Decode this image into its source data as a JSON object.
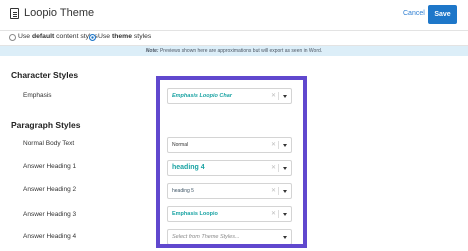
{
  "header": {
    "title": "Loopio Theme",
    "cancel_label": "Cancel",
    "save_label": "Save"
  },
  "content_styles": {
    "default_prefix": "Use",
    "default_strong": "default",
    "default_suffix": "content styles",
    "theme_prefix": "Use",
    "theme_strong": "theme",
    "theme_suffix": "styles",
    "selected": "theme"
  },
  "note": {
    "label": "Note:",
    "text": "Previews shown here are approximations but will export as seen in Word."
  },
  "sections": {
    "character_title": "Character Styles",
    "paragraph_title": "Paragraph Styles"
  },
  "rows": {
    "emphasis": {
      "label": "Emphasis",
      "value": "Emphasis Loopio Char",
      "clear": "✕"
    },
    "normal_body": {
      "label": "Normal Body Text",
      "value": "Normal",
      "clear": "✕"
    },
    "answer_h1": {
      "label": "Answer Heading 1",
      "value": "heading 4",
      "clear": "✕"
    },
    "answer_h2": {
      "label": "Answer Heading 2",
      "value": "heading 5",
      "clear": "✕"
    },
    "answer_h3": {
      "label": "Answer Heading 3",
      "value": "Emphasis Loopio",
      "clear": "✕"
    },
    "answer_h4": {
      "label": "Answer Heading 4",
      "placeholder": "Select from Theme Styles..."
    }
  },
  "colors": {
    "accent": "#1e77c9",
    "teal_style": "#1aa3a3",
    "highlight_border": "#6048ce",
    "note_bg": "#dceef8"
  },
  "icons": {
    "doc": "document-icon",
    "clear": "clear-x-icon",
    "dropdown": "chevron-down-icon"
  }
}
